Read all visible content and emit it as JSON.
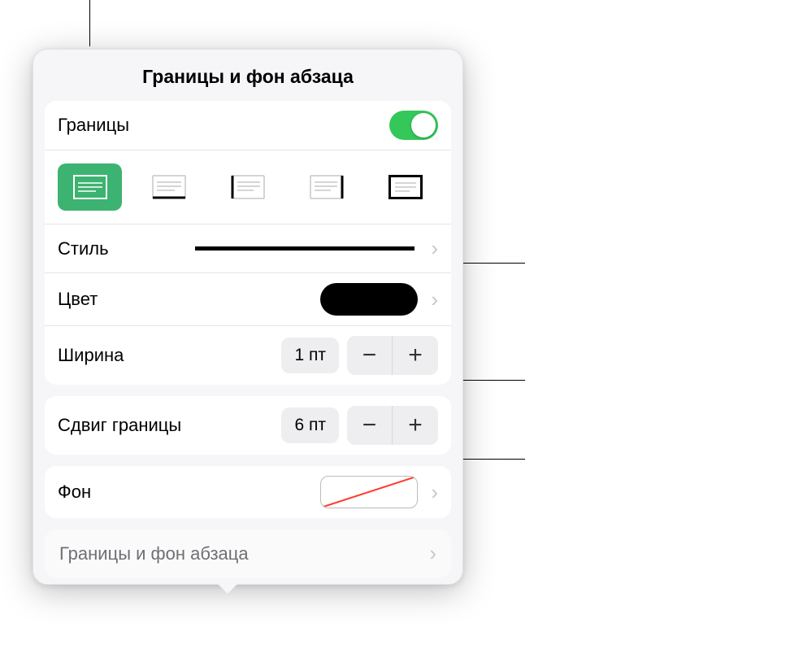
{
  "title": "Границы и фон абзаца",
  "borders": {
    "label": "Границы",
    "enabled": true,
    "presets": [
      "all",
      "bottom",
      "top-bottom",
      "top",
      "box"
    ],
    "selected": 0
  },
  "style": {
    "label": "Стиль"
  },
  "color": {
    "label": "Цвет",
    "value": "#000000"
  },
  "width": {
    "label": "Ширина",
    "value": "1 пт"
  },
  "offset": {
    "label": "Сдвиг границы",
    "value": "6 пт"
  },
  "background": {
    "label": "Фон"
  },
  "footer": {
    "label": "Границы и фон абзаца"
  }
}
